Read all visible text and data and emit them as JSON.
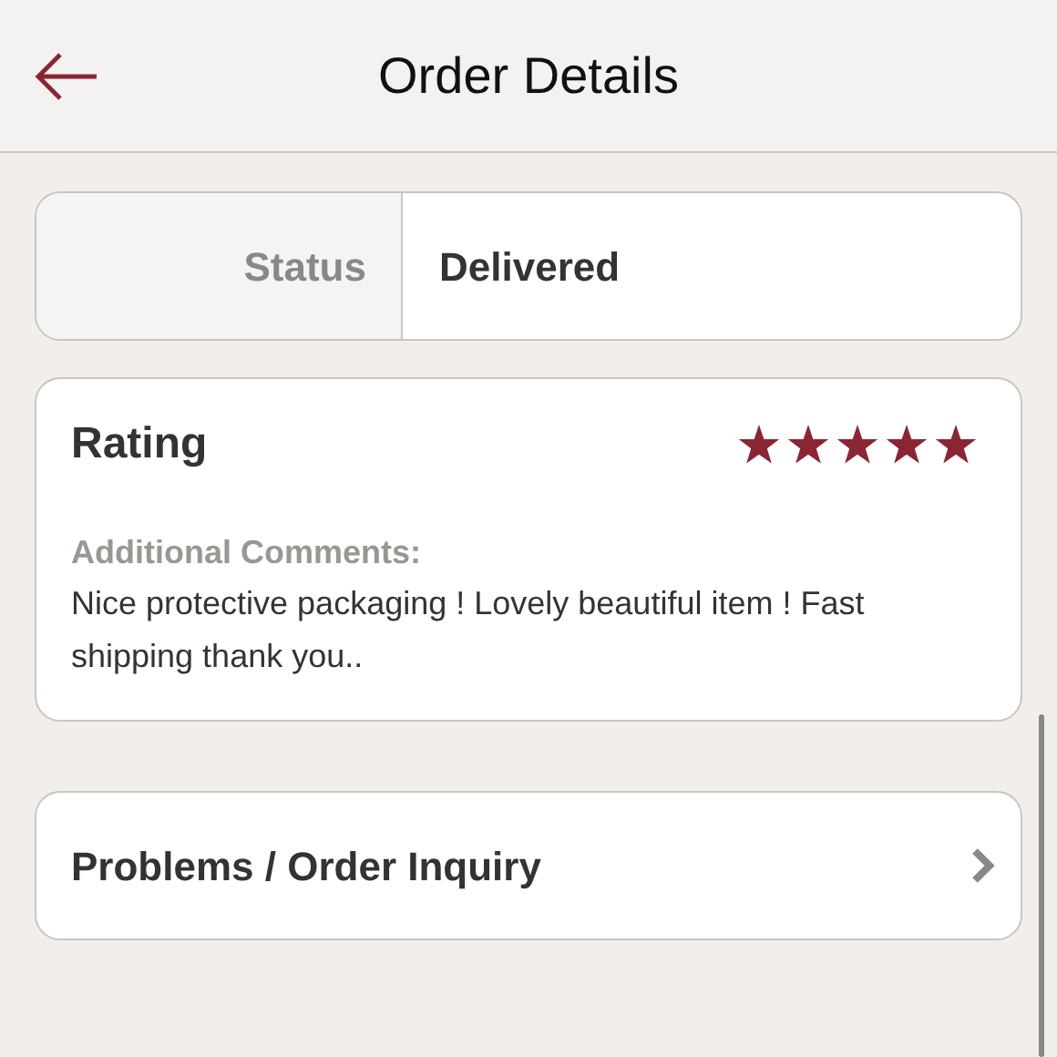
{
  "header": {
    "title": "Order Details"
  },
  "status": {
    "label": "Status",
    "value": "Delivered"
  },
  "rating": {
    "title": "Rating",
    "stars": 5,
    "comments_label": "Additional Comments:",
    "comments": "Nice protective packaging ! Lovely beautiful item ! Fast shipping thank you.."
  },
  "links": [
    {
      "label": "Problems / Order Inquiry"
    }
  ]
}
